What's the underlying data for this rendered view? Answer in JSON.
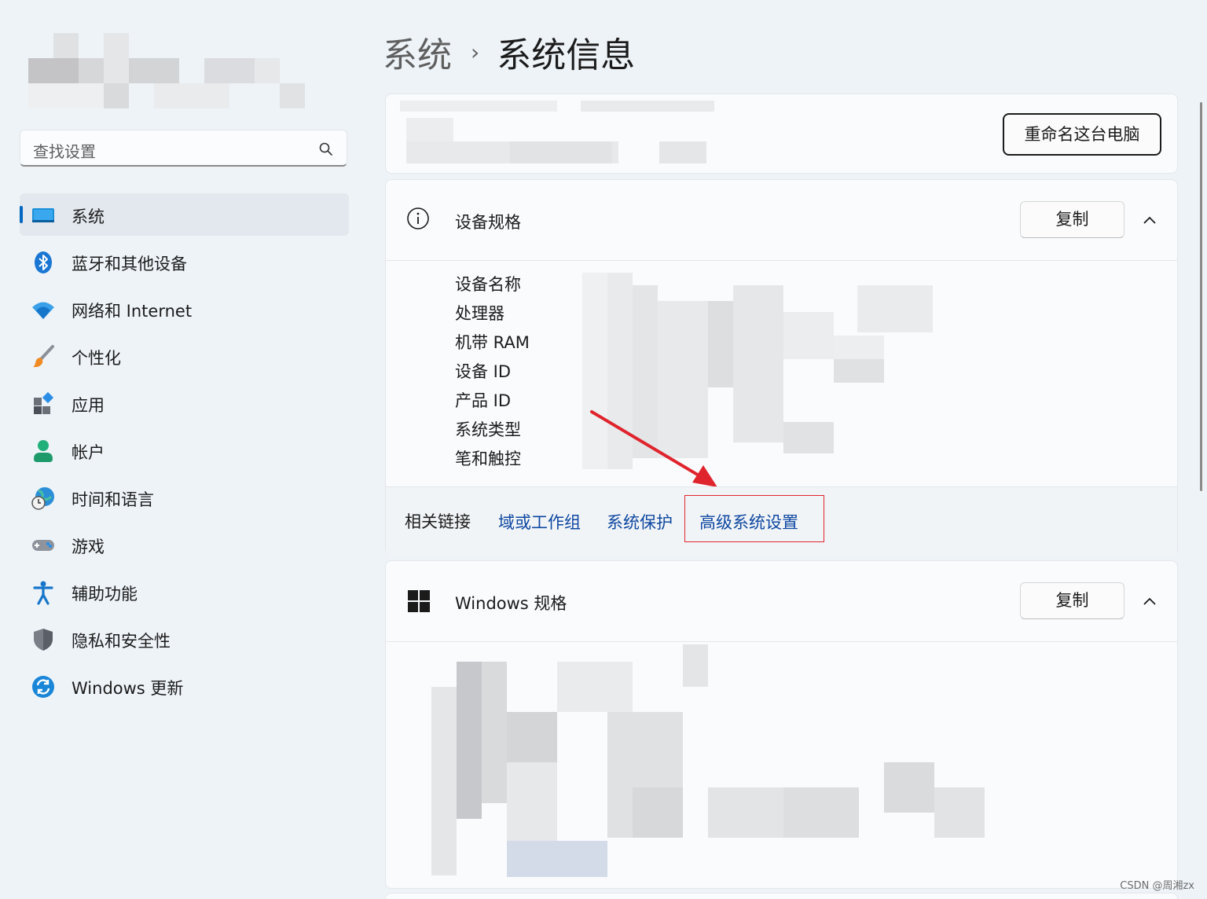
{
  "search": {
    "placeholder": "查找设置"
  },
  "nav": {
    "items": [
      {
        "label": "系统",
        "icon": "display-icon",
        "active": true
      },
      {
        "label": "蓝牙和其他设备",
        "icon": "bluetooth-icon"
      },
      {
        "label": "网络和 Internet",
        "icon": "wifi-icon"
      },
      {
        "label": "个性化",
        "icon": "paintbrush-icon"
      },
      {
        "label": "应用",
        "icon": "apps-icon"
      },
      {
        "label": "帐户",
        "icon": "person-icon"
      },
      {
        "label": "时间和语言",
        "icon": "globe-clock-icon"
      },
      {
        "label": "游戏",
        "icon": "gamepad-icon"
      },
      {
        "label": "辅助功能",
        "icon": "accessibility-icon"
      },
      {
        "label": "隐私和安全性",
        "icon": "shield-icon"
      },
      {
        "label": "Windows 更新",
        "icon": "update-icon"
      }
    ]
  },
  "breadcrumb": {
    "parent": "系统",
    "separator": "›",
    "current": "系统信息"
  },
  "header_card": {
    "rename_label": "重命名这台电脑"
  },
  "device_specs": {
    "title": "设备规格",
    "copy_label": "复制",
    "labels": [
      "设备名称",
      "处理器",
      "机带 RAM",
      "设备 ID",
      "产品 ID",
      "系统类型",
      "笔和触控"
    ]
  },
  "related": {
    "title": "相关链接",
    "links": [
      "域或工作组",
      "系统保护",
      "高级系统设置"
    ]
  },
  "windows_specs": {
    "title": "Windows 规格",
    "copy_label": "复制"
  },
  "watermark": "CSDN @周湘zx",
  "colors": {
    "accent": "#0067c0",
    "link": "#0d47a1",
    "highlight": "#e0242d",
    "arrow": "#e0242d"
  }
}
